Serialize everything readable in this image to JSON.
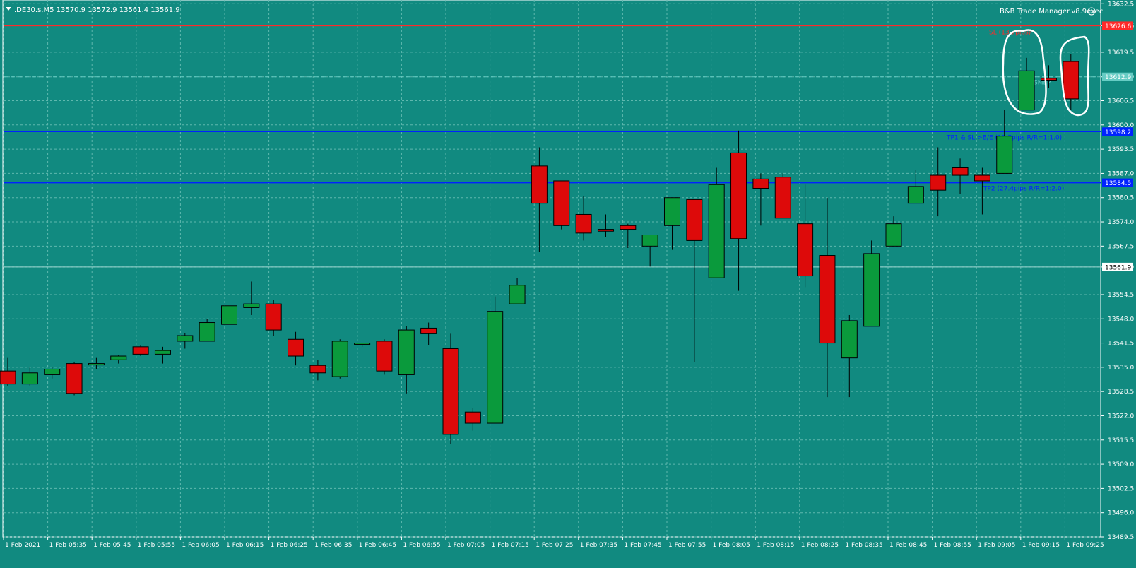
{
  "header": {
    "symbol": ".DE30.s,M5",
    "ohlc": "13570.9 13572.9 13561.4 13561.9",
    "indicator": "B&B Trade Manager.v8.9exec"
  },
  "colors": {
    "background": "#118a80",
    "grid": "#5fb8ae",
    "bull": "#0a9a3c",
    "bear": "#dd0a0a",
    "sl_line": "#ff2a2a",
    "tp_line": "#0022ff",
    "entry_line": "#66ccc4",
    "axis_text": "#ffffff"
  },
  "chart_data": {
    "type": "candlestick",
    "ylim": [
      13489.5,
      13633.5
    ],
    "y_ticks": [
      "13632.5",
      "13626.6",
      "13619.5",
      "13612.9",
      "13606.5",
      "13600.0",
      "13593.5",
      "13587.0",
      "13580.5",
      "13574.0",
      "13567.5",
      "13561.9",
      "13554.5",
      "13548.0",
      "13541.5",
      "13535.0",
      "13528.5",
      "13522.0",
      "13515.5",
      "13509.0",
      "13502.5",
      "13496.0",
      "13489.5"
    ],
    "x_ticks": [
      "1 Feb 2021",
      "1 Feb 05:35",
      "1 Feb 05:45",
      "1 Feb 05:55",
      "1 Feb 06:05",
      "1 Feb 06:15",
      "1 Feb 06:25",
      "1 Feb 06:35",
      "1 Feb 06:45",
      "1 Feb 06:55",
      "1 Feb 07:05",
      "1 Feb 07:15",
      "1 Feb 07:25",
      "1 Feb 07:35",
      "1 Feb 07:45",
      "1 Feb 07:55",
      "1 Feb 08:05",
      "1 Feb 08:15",
      "1 Feb 08:25",
      "1 Feb 08:35",
      "1 Feb 08:45",
      "1 Feb 08:55",
      "1 Feb 09:05",
      "1 Feb 09:15",
      "1 Feb 09:25"
    ],
    "candles": [
      {
        "o": 13534.0,
        "h": 13537.5,
        "l": 13530.0,
        "c": 13530.5
      },
      {
        "o": 13530.5,
        "h": 13535.0,
        "l": 13530.0,
        "c": 13533.5
      },
      {
        "o": 13533.0,
        "h": 13535.0,
        "l": 13532.0,
        "c": 13534.5
      },
      {
        "o": 13536.0,
        "h": 13536.5,
        "l": 13527.5,
        "c": 13528.0
      },
      {
        "o": 13535.8,
        "h": 13537.5,
        "l": 13534.5,
        "c": 13536.0
      },
      {
        "o": 13537.0,
        "h": 13538.2,
        "l": 13536.0,
        "c": 13538.0
      },
      {
        "o": 13540.5,
        "h": 13541.0,
        "l": 13538.0,
        "c": 13538.5
      },
      {
        "o": 13538.5,
        "h": 13540.5,
        "l": 13536.0,
        "c": 13539.5
      },
      {
        "o": 13542.0,
        "h": 13544.2,
        "l": 13540.0,
        "c": 13543.5
      },
      {
        "o": 13542.0,
        "h": 13548.0,
        "l": 13542.0,
        "c": 13547.0
      },
      {
        "o": 13546.5,
        "h": 13551.5,
        "l": 13546.5,
        "c": 13551.5
      },
      {
        "o": 13551.0,
        "h": 13558.0,
        "l": 13549.0,
        "c": 13552.0
      },
      {
        "o": 13552.0,
        "h": 13553.0,
        "l": 13543.5,
        "c": 13545.0
      },
      {
        "o": 13542.5,
        "h": 13544.5,
        "l": 13535.5,
        "c": 13538.0
      },
      {
        "o": 13535.5,
        "h": 13537.0,
        "l": 13531.5,
        "c": 13533.5
      },
      {
        "o": 13532.5,
        "h": 13542.5,
        "l": 13532.0,
        "c": 13542.0
      },
      {
        "o": 13541.5,
        "h": 13541.5,
        "l": 13540.5,
        "c": 13541.5
      },
      {
        "o": 13542.0,
        "h": 13542.5,
        "l": 13533.0,
        "c": 13534.0
      },
      {
        "o": 13533.0,
        "h": 13546.0,
        "l": 13528.0,
        "c": 13545.0
      },
      {
        "o": 13545.5,
        "h": 13547.0,
        "l": 13541.0,
        "c": 13544.0
      },
      {
        "o": 13540.0,
        "h": 13544.0,
        "l": 13514.5,
        "c": 13517.0
      },
      {
        "o": 13523.0,
        "h": 13524.0,
        "l": 13518.0,
        "c": 13520.0
      },
      {
        "o": 13520.0,
        "h": 13554.0,
        "l": 13520.0,
        "c": 13550.0
      },
      {
        "o": 13552.0,
        "h": 13559.0,
        "l": 13552.0,
        "c": 13557.0
      },
      {
        "o": 13589.0,
        "h": 13594.0,
        "l": 13566.0,
        "c": 13579.0
      },
      {
        "o": 13585.0,
        "h": 13585.0,
        "l": 13572.0,
        "c": 13573.0
      },
      {
        "o": 13576.0,
        "h": 13581.0,
        "l": 13569.0,
        "c": 13571.0
      },
      {
        "o": 13572.0,
        "h": 13576.0,
        "l": 13570.0,
        "c": 13571.5
      },
      {
        "o": 13573.0,
        "h": 13573.5,
        "l": 13567.0,
        "c": 13572.0
      },
      {
        "o": 13567.5,
        "h": 13570.5,
        "l": 13562.0,
        "c": 13570.5
      },
      {
        "o": 13573.0,
        "h": 13580.5,
        "l": 13566.5,
        "c": 13580.5
      },
      {
        "o": 13580.0,
        "h": 13580.0,
        "l": 13536.5,
        "c": 13569.0
      },
      {
        "o": 13559.0,
        "h": 13588.5,
        "l": 13559.0,
        "c": 13584.0
      },
      {
        "o": 13592.5,
        "h": 13598.5,
        "l": 13555.5,
        "c": 13569.5
      },
      {
        "o": 13585.5,
        "h": 13587.0,
        "l": 13573.0,
        "c": 13583.0
      },
      {
        "o": 13586.0,
        "h": 13587.0,
        "l": 13575.0,
        "c": 13575.0
      },
      {
        "o": 13573.5,
        "h": 13584.0,
        "l": 13556.5,
        "c": 13559.5
      },
      {
        "o": 13565.0,
        "h": 13580.5,
        "l": 13527.0,
        "c": 13541.5
      },
      {
        "o": 13537.5,
        "h": 13549.0,
        "l": 13527.0,
        "c": 13547.5
      },
      {
        "o": 13546.0,
        "h": 13569.0,
        "l": 13546.0,
        "c": 13565.5
      },
      {
        "o": 13567.5,
        "h": 13575.5,
        "l": 13567.5,
        "c": 13573.5
      },
      {
        "o": 13579.0,
        "h": 13588.0,
        "l": 13579.0,
        "c": 13583.5
      },
      {
        "o": 13586.5,
        "h": 13594.0,
        "l": 13575.5,
        "c": 13582.5
      },
      {
        "o": 13588.5,
        "h": 13591.0,
        "l": 13581.5,
        "c": 13586.5
      },
      {
        "o": 13586.5,
        "h": 13588.5,
        "l": 13576.0,
        "c": 13585.0
      },
      {
        "o": 13587.0,
        "h": 13604.0,
        "l": 13587.0,
        "c": 13597.0
      },
      {
        "o": 13604.0,
        "h": 13618.0,
        "l": 13604.0,
        "c": 13614.5
      },
      {
        "o": 13612.5,
        "h": 13616.0,
        "l": 13610.0,
        "c": 13612.0
      },
      {
        "o": 13617.0,
        "h": 13619.0,
        "l": 13604.0,
        "c": 13607.0
      }
    ],
    "levels": [
      {
        "name": "sl",
        "price": 13626.6,
        "tag": "13626.6",
        "label": "SL (13.7pips)"
      },
      {
        "name": "entry",
        "price": 13612.9,
        "tag": "13612.9",
        "label": "SMEP"
      },
      {
        "name": "tp1",
        "price": 13598.2,
        "tag": "13598.2",
        "label": "TP1 & SL->B/E (13.7pips R/R=1:1.0)"
      },
      {
        "name": "tp2",
        "price": 13584.5,
        "tag": "13584.5",
        "label": "TP2 (27.4pips R/R=1:2.0)"
      },
      {
        "name": "bid",
        "price": 13561.9,
        "tag": "13561.9",
        "label": ""
      }
    ]
  }
}
